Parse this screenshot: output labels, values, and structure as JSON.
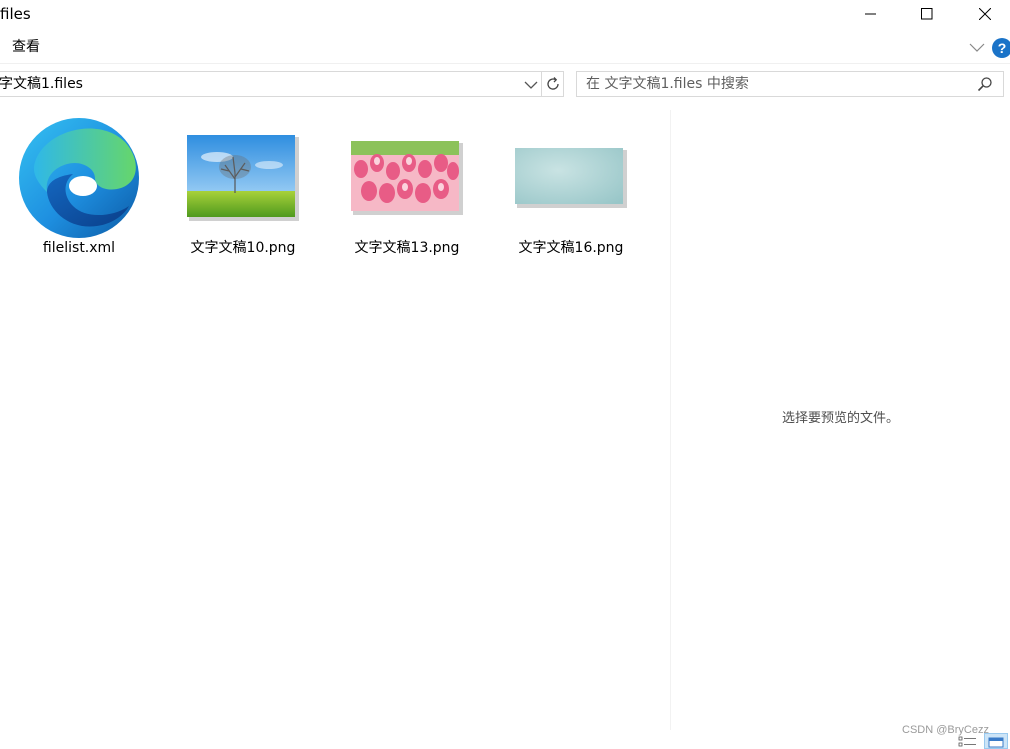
{
  "window": {
    "title": "files"
  },
  "ribbon": {
    "view_tab": "查看",
    "help_label": "?"
  },
  "address": {
    "path": "字文稿1.files"
  },
  "search": {
    "placeholder": "在 文字文稿1.files 中搜索"
  },
  "files": [
    {
      "name": "filelist.xml",
      "icon": "edge-icon"
    },
    {
      "name": "文字文稿10.png",
      "icon": "tree-thumbnail"
    },
    {
      "name": "文字文稿13.png",
      "icon": "tulips-thumbnail"
    },
    {
      "name": "文字文稿16.png",
      "icon": "teal-texture-thumbnail"
    }
  ],
  "preview": {
    "message": "选择要预览的文件。"
  },
  "status": {
    "watermark": "CSDN @BryCezz"
  },
  "colors": {
    "accent": "#1a73c8",
    "border": "#d9d9d9",
    "selected_view": "#cce4f7"
  }
}
